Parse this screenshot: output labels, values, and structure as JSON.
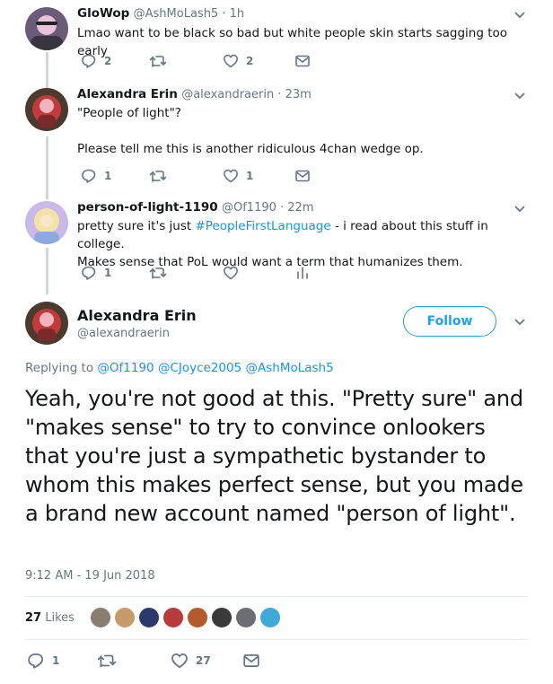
{
  "tweets": [
    {
      "name": "GloWop",
      "handle": "@AshMoLash5 · 1h",
      "text_lines": [
        "Lmao want to be black so bad but white people skin starts sagging too early"
      ],
      "replies": "2",
      "retweets": "",
      "likes": "2",
      "avatar_colors": [
        "#6b5b7a",
        "#e8c3d8",
        "#3a3340"
      ]
    },
    {
      "name": "Alexandra Erin",
      "handle": "@alexandraerin · 23m",
      "text_lines": [
        "\"People of light\"?",
        "",
        "Please tell me this is another ridiculous 4chan wedge op."
      ],
      "replies": "1",
      "retweets": "",
      "likes": "1",
      "avatar_colors": [
        "#4a3b2e",
        "#c23b3b",
        "#f0b5c0"
      ]
    },
    {
      "name": "person-of-light-1190",
      "handle": "@Of1190 · 22m",
      "text_before": "pretty sure it's just ",
      "hashtag": "#PeopleFirstLanguage",
      "text_after": " - i read about this stuff in college.",
      "text_line2": "Makes sense that PoL would want a term that humanizes them.",
      "replies": "1",
      "retweets": "",
      "likes": "",
      "avatar_colors": [
        "#c9b8e8",
        "#f4e3a6",
        "#8fa9e0"
      ]
    }
  ],
  "main": {
    "name": "Alexandra Erin",
    "handle": "@alexandraerin",
    "follow_label": "Follow",
    "replying_label": "Replying to",
    "mentions": [
      "@Of1190",
      "@CJoyce2005",
      "@AshMoLash5"
    ],
    "text": "Yeah, you're not good at this. \"Pretty sure\" and \"makes sense\" to try to convince onlookers that you're just a sympathetic bystander to whom this makes perfect sense, but you made a brand new account named \"person of light\".",
    "timestamp": "9:12 AM - 19 Jun 2018",
    "likes_count": "27",
    "likes_label": "Likes",
    "replies": "1",
    "retweets": "",
    "likes": "27"
  },
  "colors": {
    "accent": "#1da1f2",
    "link": "#1b95e0",
    "muted": "#657786",
    "thread_line": "#ccd6dd"
  },
  "liker_colors": [
    "#8a7f6e",
    "#c79b6a",
    "#2b3a6b",
    "#b83a3a",
    "#b55a2a",
    "#3a3a3a",
    "#6b6f73",
    "#3fa9d8"
  ]
}
